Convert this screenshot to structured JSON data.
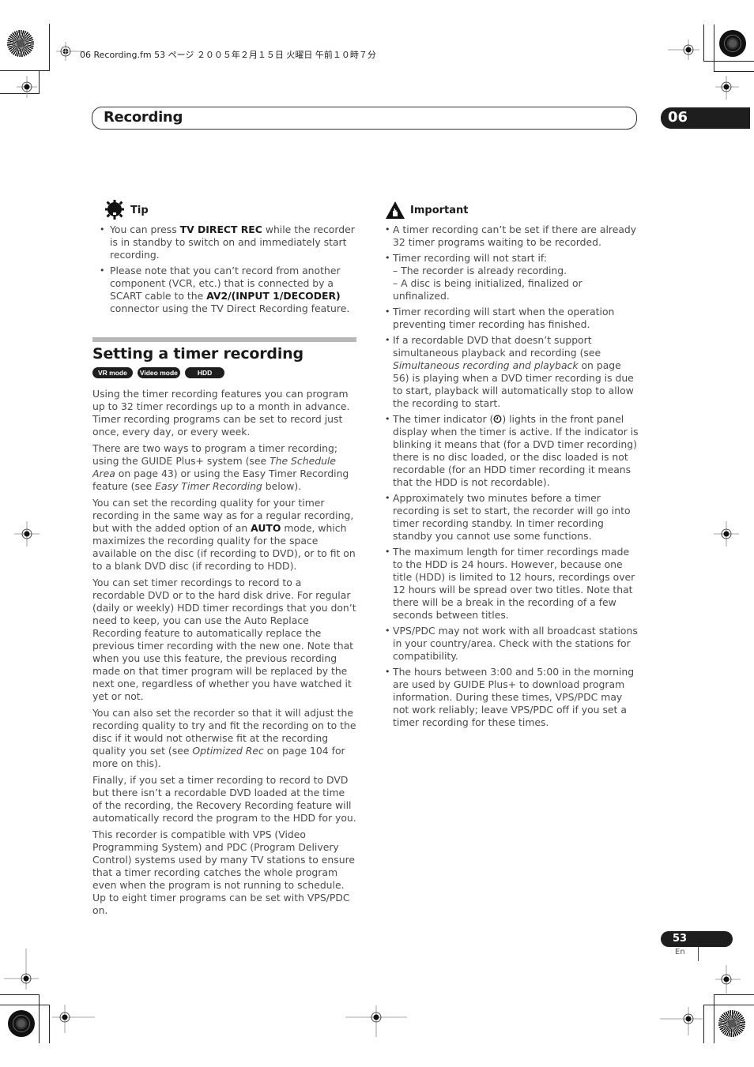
{
  "file_info": "06 Recording.fm  53 ページ  ２００５年２月１５日  火曜日  午前１０時７分",
  "header": {
    "chapter_title": "Recording",
    "chapter_number": "06"
  },
  "tip": {
    "icon": "lightbulb-gear-icon",
    "label": "Tip",
    "items": [
      {
        "pre": "You can press ",
        "bold": "TV DIRECT REC",
        "post": " while the recorder is in standby to switch on and immediately start recording."
      },
      {
        "pre": "Please note that you can’t record from another component (VCR, etc.) that is connected by a SCART cable to the ",
        "bold": "AV2/(INPUT 1/DECODER)",
        "post": " connector using the TV Direct Recording feature."
      }
    ]
  },
  "section": {
    "title": "Setting a timer recording",
    "badges": [
      "VR mode",
      "Video mode",
      "HDD"
    ],
    "paragraphs": [
      {
        "text": "Using the timer recording features you can program up to 32 timer recordings up to a month in advance. Timer recording programs can be set to record just once, every day, or every week."
      },
      {
        "p1": "There are two ways to program a timer recording; using the GUIDE Plus+ system (see ",
        "i1": "The Schedule Area",
        "p2": " on page 43) or using the Easy Timer Recording feature (see ",
        "i2": "Easy Timer Recording",
        "p3": " below)."
      },
      {
        "p1": "You can set the recording quality for your timer recording in the same way as for a regular recording, but with the added option of an ",
        "b1": "AUTO",
        "p2": " mode, which maximizes the recording quality for the space available on the disc (if recording to DVD), or to fit on to a blank DVD disc (if recording to HDD)."
      },
      {
        "text": "You can set timer recordings to record to a recordable DVD or to the hard disk drive. For regular (daily or weekly) HDD timer recordings that you don’t need to keep, you can use the Auto Replace Recording feature to automatically replace the previous timer recording with the new one. Note that when you use this feature, the previous recording made on that timer program will be replaced by the next one, regardless of whether you have watched it yet or not."
      },
      {
        "p1": "You can also set the recorder so that it will adjust the recording quality to try and fit the recording on to the disc if it would not otherwise fit at the recording quality you set (see ",
        "i1": "Optimized Rec",
        "p2": " on page 104 for more on this)."
      },
      {
        "text": "Finally, if you set a timer recording to record to DVD but there isn’t a recordable DVD loaded at the time of the recording, the Recovery Recording feature will automatically record the program to the HDD for you."
      },
      {
        "text": "This recorder is compatible with VPS (Video Programming System) and PDC (Program Delivery Control) systems used by many TV stations to ensure that a timer recording catches the whole program even when the program is not running to schedule. Up to eight timer programs can be set with VPS/PDC on."
      }
    ]
  },
  "important": {
    "icon": "warning-hand-icon",
    "label": "Important",
    "items": [
      {
        "text": "A timer recording can’t be set if there are already 32 timer programs waiting to be recorded."
      },
      {
        "text": "Timer recording will not start if:",
        "subs": [
          "– The recorder is already recording.",
          "– A disc is being initialized, finalized or unfinalized."
        ]
      },
      {
        "text": "Timer recording will start when the operation preventing timer recording has finished."
      },
      {
        "p1": "If a recordable DVD that doesn’t support simultaneous playback and recording (see ",
        "i1": "Simultaneous recording and playback",
        "p2": " on page 56) is playing when a DVD timer recording is due to start, playback will automatically stop to allow the recording to start."
      },
      {
        "p1": "The timer indicator (",
        "glyph": "⊘",
        "p2": ") lights in the front panel display when the timer is active. If the indicator is blinking it means that (for a DVD timer recording) there is no disc loaded, or the disc loaded is not recordable (for an HDD timer recording it means that the HDD is not recordable)."
      },
      {
        "text": "Approximately two minutes before a timer recording is set to start, the recorder will go into timer recording standby. In timer recording standby you cannot use some functions."
      },
      {
        "text": "The maximum length for timer recordings made to the HDD is 24 hours. However, because one title (HDD) is limited to 12 hours, recordings over 12 hours will be spread over two titles. Note that there will be a break in the recording of a few seconds between titles."
      },
      {
        "text": "VPS/PDC may not work with all broadcast stations in your country/area. Check with the stations for compatibility."
      },
      {
        "text": "The hours between 3:00 and 5:00 in the morning are used by GUIDE Plus+ to download program information. During these times, VPS/PDC may not work reliably; leave VPS/PDC off if you set a timer recording for these times."
      }
    ]
  },
  "footer": {
    "page_number": "53",
    "language": "En"
  }
}
